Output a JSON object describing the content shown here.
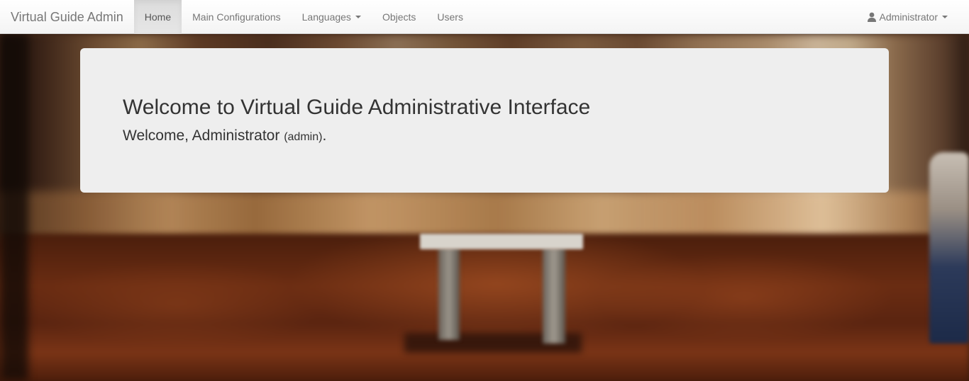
{
  "navbar": {
    "brand": "Virtual Guide Admin",
    "items": [
      {
        "label": "Home",
        "active": true
      },
      {
        "label": "Main Configurations"
      },
      {
        "label": "Languages",
        "dropdown": true
      },
      {
        "label": "Objects"
      },
      {
        "label": "Users"
      }
    ],
    "user_menu": {
      "icon": "user-icon",
      "label": "Administrator",
      "dropdown": true
    }
  },
  "jumbotron": {
    "heading": "Welcome to Virtual Guide Administrative Interface",
    "welcome_prefix": "Welcome, Administrator",
    "username": "(admin)",
    "suffix": "."
  },
  "colors": {
    "navbar_bg": "#f8f8f8",
    "active_item_bg": "#e7e7e7",
    "jumbotron_bg": "#eeeeee",
    "nav_text": "#777777"
  }
}
